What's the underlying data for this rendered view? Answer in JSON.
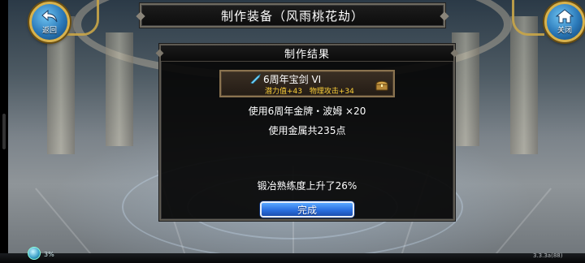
{
  "window": {
    "title": "制作装备（风雨桃花劫）"
  },
  "corner_buttons": {
    "back_label": "返回",
    "back_icon": "back-arrow-icon",
    "close_label": "关闭",
    "close_icon": "home-icon"
  },
  "dialog": {
    "title": "制作结果",
    "item": {
      "name": "6周年宝剑 VI",
      "icon": "sword-crystal-icon",
      "stats": [
        "潜力值+43",
        "物理攻击+34"
      ],
      "badge_icon": "treasure-chest-icon"
    },
    "materials_line": "使用6周年金牌・波姆  ×20",
    "metal_line": "使用金属共235点",
    "proficiency_line": "锻冶熟练度上升了26%",
    "confirm_label": "完成"
  },
  "status": {
    "progress_text": "3%",
    "version": "3.3.3a(88)"
  },
  "colors": {
    "stat_yellow": "#ffd23a",
    "button_blue": "#2a6fe0",
    "frame_gold": "#d8b24c"
  }
}
